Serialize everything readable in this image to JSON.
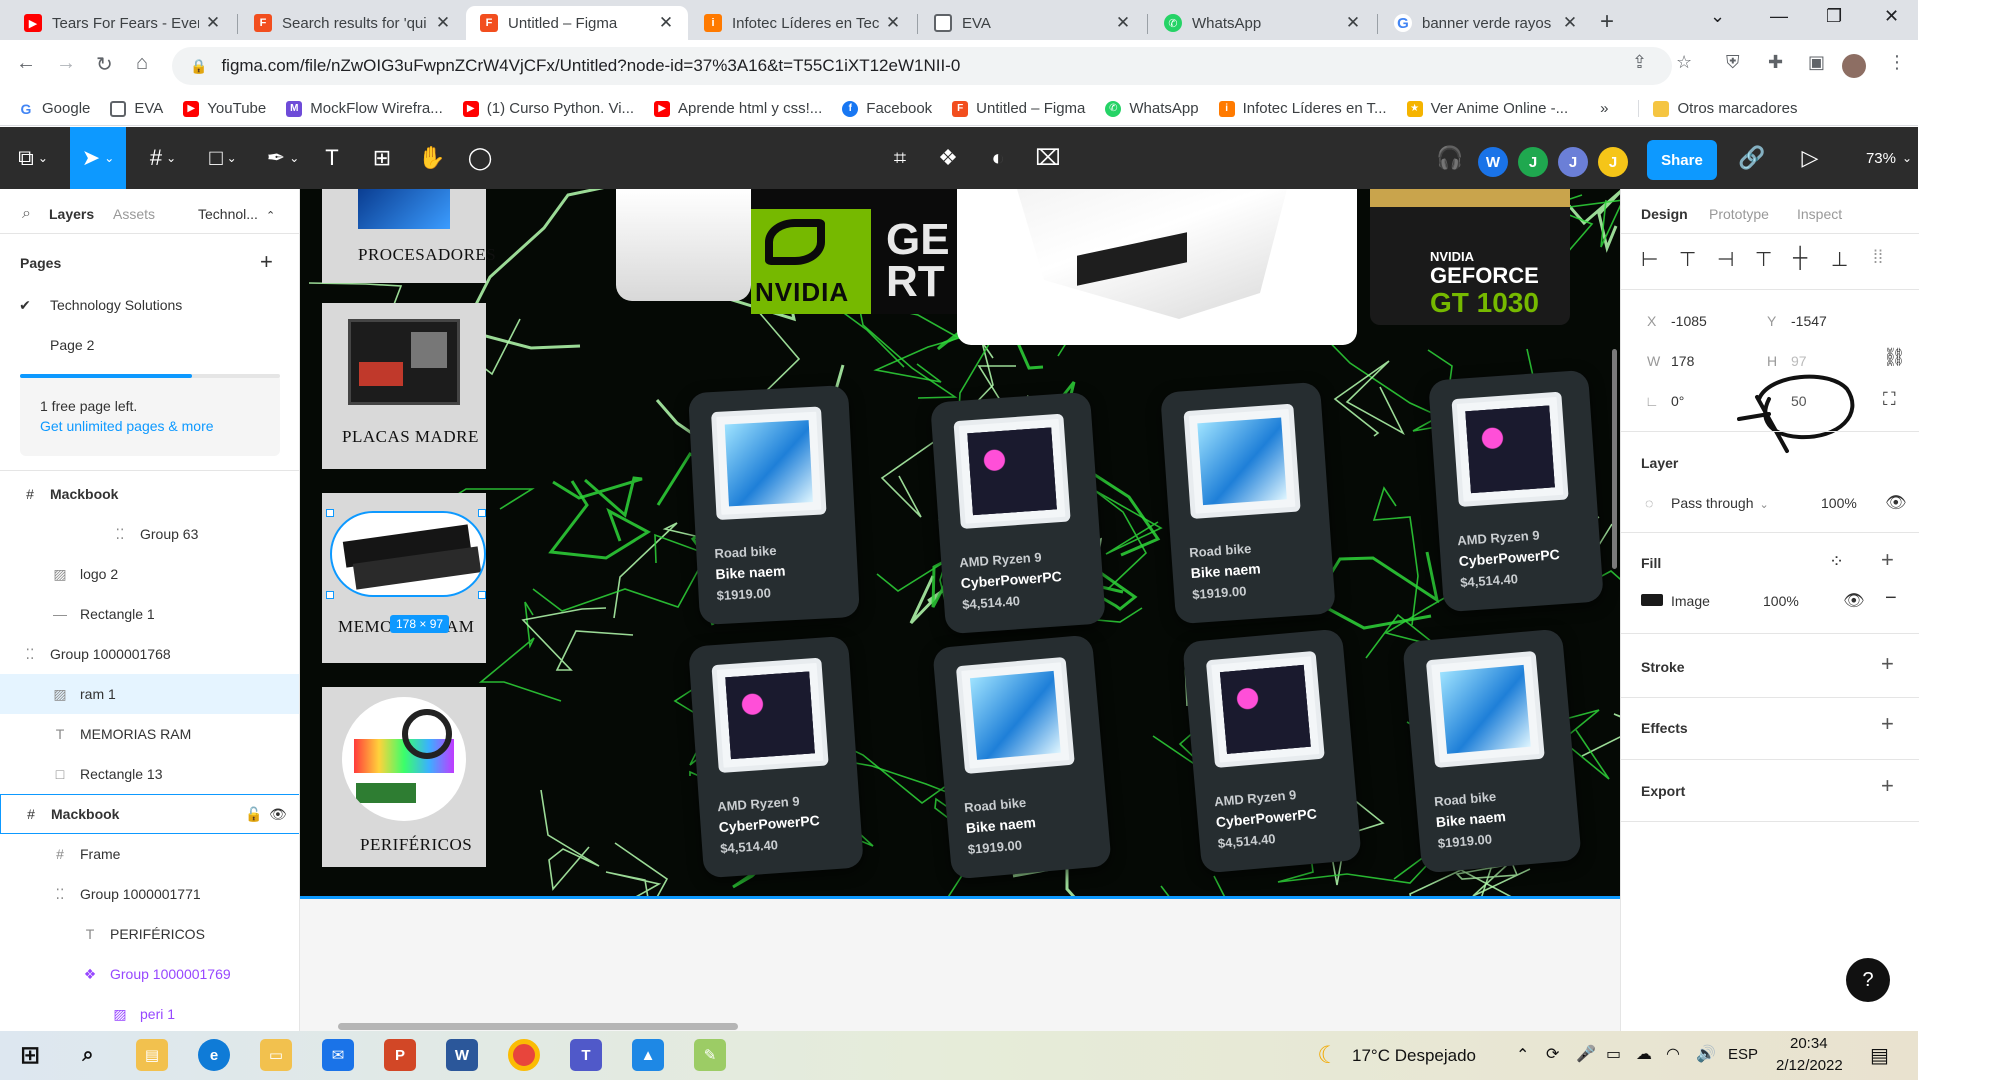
{
  "browser": {
    "tabs": [
      {
        "title": "Tears For Fears - Every",
        "favicon": "youtube-icon",
        "color": "#ff0000",
        "active": false
      },
      {
        "title": "Search results for 'qui",
        "favicon": "figma-icon",
        "color": "#f24e1e",
        "active": false
      },
      {
        "title": "Untitled – Figma",
        "favicon": "figma-icon",
        "color": "#f24e1e",
        "active": true
      },
      {
        "title": "Infotec Líderes en Tec",
        "favicon": "infotec-icon",
        "color": "#ff7a00",
        "active": false
      },
      {
        "title": "EVA",
        "favicon": "document-icon",
        "color": "#5f6368",
        "active": false
      },
      {
        "title": "WhatsApp",
        "favicon": "whatsapp-icon",
        "color": "#25d366",
        "active": false
      },
      {
        "title": "banner verde rayos -",
        "favicon": "google-icon",
        "color": "#4285f4",
        "active": false
      }
    ],
    "url": "figma.com/file/nZwOIG3uFwpnZCrW4VjCFx/Untitled?node-id=37%3A16&t=T55C1iXT12eW1NII-0",
    "bookmarks": [
      {
        "label": "Google",
        "icon": "google-icon",
        "color": "#4285f4"
      },
      {
        "label": "EVA",
        "icon": "document-icon",
        "color": "#5f6368"
      },
      {
        "label": "YouTube",
        "icon": "youtube-icon",
        "color": "#ff0000"
      },
      {
        "label": "MockFlow Wirefra...",
        "icon": "mockflow-icon",
        "color": "#6e4bd8"
      },
      {
        "label": "(1) Curso Python. Vi...",
        "icon": "youtube-icon",
        "color": "#ff0000"
      },
      {
        "label": "Aprende html y css!...",
        "icon": "youtube-icon",
        "color": "#ff0000"
      },
      {
        "label": "Facebook",
        "icon": "facebook-icon",
        "color": "#1877f2"
      },
      {
        "label": "Untitled – Figma",
        "icon": "figma-icon",
        "color": "#f24e1e"
      },
      {
        "label": "WhatsApp",
        "icon": "whatsapp-icon",
        "color": "#25d366"
      },
      {
        "label": "Infotec Líderes en T...",
        "icon": "infotec-icon",
        "color": "#ff7a00"
      },
      {
        "label": "Ver Anime Online -...",
        "icon": "anime-icon",
        "color": "#f5b400"
      }
    ],
    "bookmarks_more": "»",
    "other_bookmarks": "Otros marcadores"
  },
  "figma": {
    "toolbar": {
      "avatars": [
        {
          "letter": "W",
          "color": "#1a73e8"
        },
        {
          "letter": "J",
          "color": "#1fa84f"
        },
        {
          "letter": "J",
          "color": "#6b7fd7"
        },
        {
          "letter": "J",
          "color": "#f5c518"
        }
      ],
      "share_label": "Share",
      "zoom": "73%"
    },
    "left": {
      "tabs": {
        "layers": "Layers",
        "assets": "Assets",
        "page_select": "Technol..."
      },
      "pages_title": "Pages",
      "pages": [
        {
          "name": "Technology Solutions",
          "current": true
        },
        {
          "name": "Page 2",
          "current": false
        }
      ],
      "free_pages_text": "1 free page left.",
      "upgrade_link": "Get unlimited pages & more",
      "layers": [
        {
          "name": "Mackbook",
          "icon": "frame-icon",
          "indent": 0,
          "style": "bold"
        },
        {
          "name": "Group 63",
          "icon": "group-icon",
          "indent": 3,
          "style": "normal"
        },
        {
          "name": "logo 2",
          "icon": "image-icon",
          "indent": 1,
          "style": "normal"
        },
        {
          "name": "Rectangle 1",
          "icon": "line-icon",
          "indent": 1,
          "style": "normal"
        },
        {
          "name": "Group 1000001768",
          "icon": "group-icon",
          "indent": 0,
          "style": "normal"
        },
        {
          "name": "ram 1",
          "icon": "image-icon",
          "indent": 1,
          "style": "selected"
        },
        {
          "name": "MEMORIAS RAM",
          "icon": "text-icon",
          "indent": 1,
          "style": "normal"
        },
        {
          "name": "Rectangle 13",
          "icon": "rectangle-icon",
          "indent": 1,
          "style": "normal"
        },
        {
          "name": "Mackbook",
          "icon": "frame-icon",
          "indent": 0,
          "style": "outlined"
        },
        {
          "name": "Frame",
          "icon": "frame-icon",
          "indent": 1,
          "style": "normal"
        },
        {
          "name": "Group 1000001771",
          "icon": "group-icon",
          "indent": 1,
          "style": "normal"
        },
        {
          "name": "PERIFÉRICOS",
          "icon": "text-icon",
          "indent": 2,
          "style": "normal"
        },
        {
          "name": "Group 1000001769",
          "icon": "component-icon",
          "indent": 2,
          "style": "purple"
        },
        {
          "name": "peri 1",
          "icon": "image-icon",
          "indent": 3,
          "style": "purple"
        }
      ]
    },
    "canvas": {
      "categories": [
        {
          "label": "PROCESADORES"
        },
        {
          "label": "PLACAS MADRE"
        },
        {
          "label": "MEMO",
          "label_suffix": "AM"
        },
        {
          "label": "PERIFÉRICOS"
        }
      ],
      "selection_size": "178 × 97",
      "banner": {
        "brand_text": "NVIDIA",
        "partial_text": "GE\nRT",
        "card_text_1": "NVIDIA",
        "card_text_2": "GEFORCE",
        "card_text_3": "GT 1030"
      },
      "products": [
        {
          "subtitle": "Road bike",
          "name": "Bike naem",
          "price": "$1919.00",
          "case": "blue"
        },
        {
          "subtitle": "AMD Ryzen 9",
          "name": "CyberPowerPC",
          "price": "$4,514.40",
          "case": "rgb"
        },
        {
          "subtitle": "Road bike",
          "name": "Bike naem",
          "price": "$1919.00",
          "case": "blue"
        },
        {
          "subtitle": "AMD Ryzen 9",
          "name": "CyberPowerPC",
          "price": "$4,514.40",
          "case": "rgb"
        },
        {
          "subtitle": "AMD Ryzen 9",
          "name": "CyberPowerPC",
          "price": "$4,514.40",
          "case": "rgb"
        },
        {
          "subtitle": "Road bike",
          "name": "Bike naem",
          "price": "$1919.00",
          "case": "blue"
        },
        {
          "subtitle": "AMD Ryzen 9",
          "name": "CyberPowerPC",
          "price": "$4,514.40",
          "case": "rgb"
        },
        {
          "subtitle": "Road bike",
          "name": "Bike naem",
          "price": "$1919.00",
          "case": "blue"
        }
      ]
    },
    "right": {
      "tabs": {
        "design": "Design",
        "prototype": "Prototype",
        "inspect": "Inspect"
      },
      "x_label": "X",
      "x_value": "-1085",
      "y_label": "Y",
      "y_value": "-1547",
      "w_label": "W",
      "w_value": "178",
      "h_label": "H",
      "h_value": "97",
      "rotation": "0°",
      "radius": "50",
      "layer_title": "Layer",
      "blend": "Pass through",
      "layer_opacity": "100%",
      "fill_title": "Fill",
      "fill_type": "Image",
      "fill_opacity": "100%",
      "stroke_title": "Stroke",
      "effects_title": "Effects",
      "export_title": "Export",
      "help": "?"
    }
  },
  "taskbar": {
    "weather": "17°C  Despejado",
    "lang": "ESP",
    "time": "20:34",
    "date": "2/12/2022"
  },
  "colors": {
    "figma_blue": "#0d99ff",
    "figma_dark": "#2c2c2c",
    "neon_green": "#39ff3a",
    "card_bg": "#262d30"
  }
}
